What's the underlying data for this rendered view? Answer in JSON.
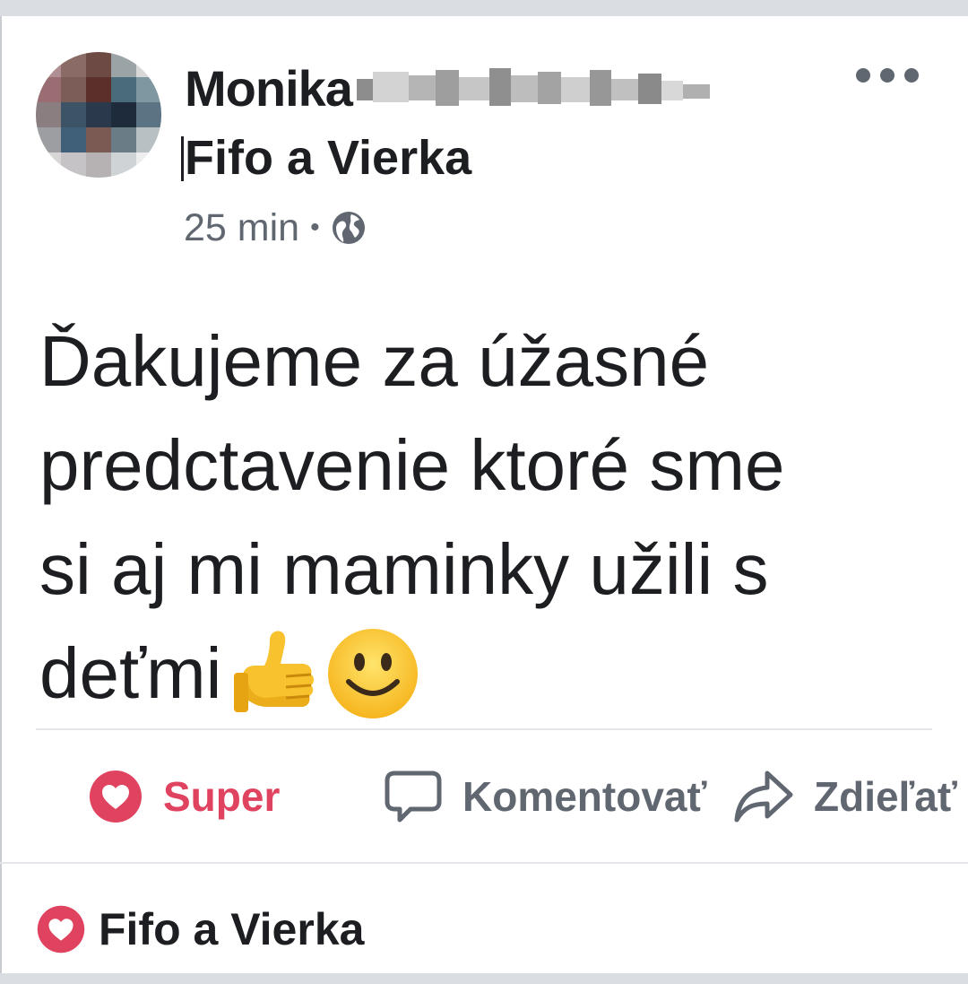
{
  "post": {
    "author_name": "Monika",
    "group_name": "Fifo a Vierka",
    "time": "25 min",
    "separator": "•",
    "privacy_icon": "globe-icon",
    "more_icon": "more-icon",
    "text_lines": [
      "Ďakujeme za úžasné",
      "predctavenie ktoré sme",
      "si aj mi maminky užili s",
      "deťmi"
    ],
    "emojis": [
      "thumbs-up-emoji",
      "smiling-face-emoji"
    ]
  },
  "actions": {
    "super": {
      "label": "Super",
      "icon": "heart-icon",
      "color": "#e0435f"
    },
    "comment": {
      "label": "Komentovať",
      "icon": "comment-icon"
    },
    "share": {
      "label": "Zdieľať",
      "icon": "share-icon"
    }
  },
  "reactions": {
    "icon": "heart-icon",
    "label": "Fifo a Vierka"
  },
  "colors": {
    "text_primary": "#1c1e21",
    "text_secondary": "#606770",
    "love_red": "#e0435f",
    "band_gray": "#dadde1"
  }
}
